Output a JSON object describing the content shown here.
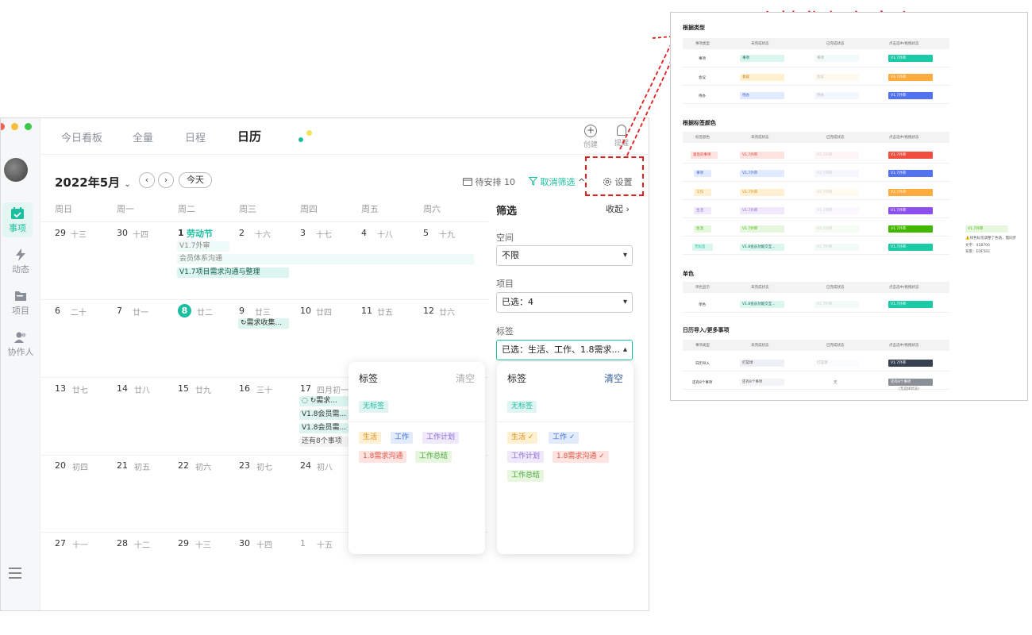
{
  "app": {
    "sidebar": {
      "nav": [
        {
          "label": "事项",
          "icon": "calendar-check-icon",
          "active": true
        },
        {
          "label": "动态",
          "icon": "lightning-icon"
        },
        {
          "label": "项目",
          "icon": "folder-icon"
        },
        {
          "label": "协作人",
          "icon": "people-icon"
        }
      ]
    },
    "topnav": {
      "tabs": [
        "今日看板",
        "全量",
        "日程",
        "日历"
      ],
      "create_label": "创建",
      "notify_label": "提醒"
    },
    "header": {
      "month": "2022年5月",
      "prev": "‹",
      "next": "›",
      "today": "今天",
      "pending": "待安排 10",
      "cancel_filter": "取消筛选",
      "settings": "设置"
    },
    "weekdays": [
      "周日",
      "周一",
      "周二",
      "周三",
      "周四",
      "周五",
      "周六"
    ],
    "weeks": [
      [
        {
          "d": "29",
          "l": "十三"
        },
        {
          "d": "30",
          "l": "十四"
        },
        {
          "d": "1",
          "l": "劳动节",
          "holiday": true
        },
        {
          "d": "2",
          "l": "十六"
        },
        {
          "d": "3",
          "l": "十七"
        },
        {
          "d": "4",
          "l": "十八"
        },
        {
          "d": "5",
          "l": "十九"
        }
      ],
      [
        {
          "d": "6",
          "l": "二十"
        },
        {
          "d": "7",
          "l": "廿一"
        },
        {
          "d": "8",
          "l": "廿二",
          "today": true
        },
        {
          "d": "9",
          "l": "廿三"
        },
        {
          "d": "10",
          "l": "廿四"
        },
        {
          "d": "11",
          "l": "廿五"
        },
        {
          "d": "12",
          "l": "廿六"
        }
      ],
      [
        {
          "d": "13",
          "l": "廿七"
        },
        {
          "d": "14",
          "l": "廿八"
        },
        {
          "d": "15",
          "l": "廿九"
        },
        {
          "d": "16",
          "l": "三十"
        },
        {
          "d": "17",
          "l": "四月初一"
        },
        {
          "d": "",
          "l": ""
        },
        {
          "d": "",
          "l": ""
        }
      ],
      [
        {
          "d": "20",
          "l": "初四"
        },
        {
          "d": "21",
          "l": "初五"
        },
        {
          "d": "22",
          "l": "初六"
        },
        {
          "d": "23",
          "l": "初七"
        },
        {
          "d": "24",
          "l": "初八"
        },
        {
          "d": "",
          "l": ""
        },
        {
          "d": "",
          "l": ""
        }
      ],
      [
        {
          "d": "27",
          "l": "十一"
        },
        {
          "d": "28",
          "l": "十二"
        },
        {
          "d": "29",
          "l": "十三"
        },
        {
          "d": "30",
          "l": "十四"
        },
        {
          "d": "1",
          "l": "十五"
        },
        {
          "d": "",
          "l": ""
        },
        {
          "d": "",
          "l": ""
        }
      ]
    ],
    "events": {
      "w1_a": "V1.7外审",
      "w1_b": "会员体系沟通",
      "w1_c": "V1.7项目需求沟通与整理",
      "w2_a": "需求收集...",
      "w3_a": "需求...",
      "w3_b": "V1.8会员需...",
      "w3_c": "V1.8会员需...",
      "w3_more": "还有8个事项"
    },
    "filter": {
      "title": "筛选",
      "collapse": "收起",
      "space_label": "空间",
      "space_value": "不限",
      "project_label": "项目",
      "project_value": "已选：4",
      "tag_label": "标签",
      "tag_value": "已选：生活、工作、1.8需求..."
    },
    "popup_left": {
      "title": "标签",
      "clear": "清空",
      "tags": [
        "无标签",
        "生活",
        "工作",
        "工作计划",
        "1.8需求沟通",
        "工作总结"
      ]
    },
    "popup_right": {
      "title": "标签",
      "clear": "清空",
      "tags": [
        "无标签",
        "生活",
        "工作",
        "工作计划",
        "1.8需求沟通",
        "工作总结"
      ]
    }
  },
  "reference": {
    "title": "个性化颜色定义",
    "sections": {
      "type": "根据类型",
      "tagcolor": "根据标签颜色",
      "single": "单色",
      "import": "日历导入/更多事项"
    },
    "cols_type": [
      "事项类型",
      "未完成状态",
      "已完成状态",
      "点击选中/拖拽状态"
    ],
    "cols_tag": [
      "标签颜色",
      "未完成状态",
      "已完成状态",
      "点击选中/拖拽状态"
    ],
    "cols_single": [
      "单色显示",
      "未完成状态",
      "已完成状态",
      "点击选中/拖拽状态"
    ],
    "type_rows": [
      {
        "label": "事项",
        "a": "事项",
        "b": "事项",
        "c": "V1.7外审"
      },
      {
        "label": "会议",
        "a": "会议",
        "b": "会议",
        "c": "V1.7外审"
      },
      {
        "label": "待办",
        "a": "待办",
        "b": "待办",
        "c": "V1.7外审"
      }
    ],
    "tag_rows": [
      {
        "label": "紧急的事项",
        "a": "V1.7外审",
        "b": "V1.7外审",
        "c": "V1.7外审"
      },
      {
        "label": "事项",
        "a": "V1.7外审",
        "b": "V1.7外审",
        "c": "V1.7外审"
      },
      {
        "label": "工作",
        "a": "V1.7外审",
        "b": "V1.7外审",
        "c": "V1.7外审"
      },
      {
        "label": "生活",
        "a": "V1.7外审",
        "b": "V1.7外审",
        "c": "V1.7外审"
      },
      {
        "label": "生活",
        "a": "V1.7外审",
        "b": "V1.7外审",
        "c": "V1.7外审"
      },
      {
        "label": "无标签",
        "a": "V1.8会员功能交互...",
        "b": "V1.7外审",
        "c": "V1.7外审"
      }
    ],
    "single_row": {
      "label": "单色",
      "a": "V1.8会员功能交互...",
      "b": "V1.7外审",
      "c": "V1.7外审"
    },
    "import_rows": [
      {
        "label": "日历导入",
        "a": "打篮球",
        "b": "打篮球",
        "c": "V1.7外审"
      },
      {
        "label": "还有8个事项",
        "a": "还有8个事项",
        "b": "无",
        "c": "还有8个事项",
        "note": "(无选择状态)"
      }
    ],
    "side_chip": "V1.7外审",
    "side_note1": "⚠️绿色标签调整了色值，需同步",
    "side_note2": "文字：41B700",
    "side_note3": "背景：EDF5EE"
  }
}
